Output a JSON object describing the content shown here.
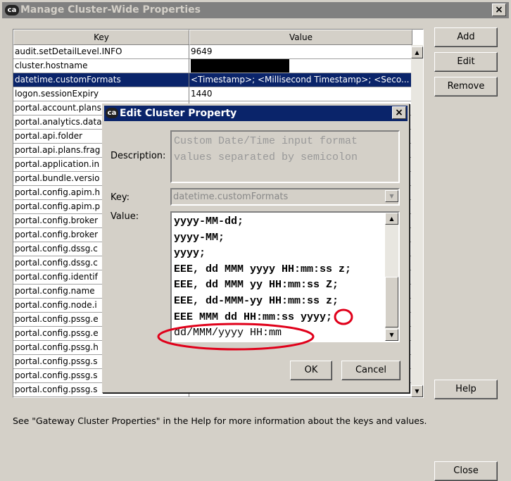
{
  "window": {
    "title": "Manage Cluster-Wide Properties",
    "logo": "ca",
    "close_icon": "close-icon"
  },
  "table": {
    "headers": [
      "Key",
      "Value"
    ],
    "rows": [
      {
        "key": "audit.setDetailLevel.INFO",
        "value": "9649"
      },
      {
        "key": "cluster.hostname",
        "value": ""
      },
      {
        "key": "datetime.customFormats",
        "value": "<Timestamp>; <Millisecond Timestamp>; <Seco..."
      },
      {
        "key": "logon.sessionExpiry",
        "value": "1440"
      },
      {
        "key": "portal.account.plans",
        "value": ""
      },
      {
        "key": "portal.analytics.data",
        "value": ""
      },
      {
        "key": "portal.api.folder",
        "value": ""
      },
      {
        "key": "portal.api.plans.frag",
        "value": ""
      },
      {
        "key": "portal.application.in",
        "value": ""
      },
      {
        "key": "portal.bundle.versio",
        "value": ""
      },
      {
        "key": "portal.config.apim.h",
        "value": ""
      },
      {
        "key": "portal.config.apim.p",
        "value": ""
      },
      {
        "key": "portal.config.broker",
        "value": ""
      },
      {
        "key": "portal.config.broker",
        "value": ""
      },
      {
        "key": "portal.config.dssg.c",
        "value": ""
      },
      {
        "key": "portal.config.dssg.c",
        "value": ""
      },
      {
        "key": "portal.config.identif",
        "value": ""
      },
      {
        "key": "portal.config.name",
        "value": ""
      },
      {
        "key": "portal.config.node.i",
        "value": ""
      },
      {
        "key": "portal.config.pssg.e",
        "value": ""
      },
      {
        "key": "portal.config.pssg.e",
        "value": ""
      },
      {
        "key": "portal.config.pssg.h",
        "value": ""
      },
      {
        "key": "portal.config.pssg.s",
        "value": ""
      },
      {
        "key": "portal.config.pssg.s",
        "value": ""
      },
      {
        "key": "portal.config.pssg.s",
        "value": ""
      }
    ],
    "selected_index": 2
  },
  "buttons": {
    "add": "Add",
    "edit": "Edit",
    "remove": "Remove",
    "help": "Help",
    "close": "Close"
  },
  "footer": "See \"Gateway Cluster Properties\" in the Help for more information about the keys and values.",
  "dialog": {
    "title": "Edit Cluster Property",
    "logo": "ca",
    "description_label": "Description:",
    "description": "Custom Date/Time input format values separated by semicolon",
    "key_label": "Key:",
    "key_value": "datetime.customFormats",
    "value_label": "Value:",
    "value_lines": [
      "yyyy-MM-dd;",
      "yyyy-MM;",
      "yyyy;",
      "EEE, dd MMM yyyy HH:mm:ss z;",
      "EEE, dd MMM yy HH:mm:ss Z;",
      "EEE, dd-MMM-yy HH:mm:ss z;",
      "EEE MMM dd HH:mm:ss yyyy;",
      "dd/MMM/yyyy HH:mm"
    ],
    "ok": "OK",
    "cancel": "Cancel"
  },
  "colors": {
    "selection": "#0a246a",
    "annotation": "#e0001a",
    "inactive_title": "#808080"
  }
}
